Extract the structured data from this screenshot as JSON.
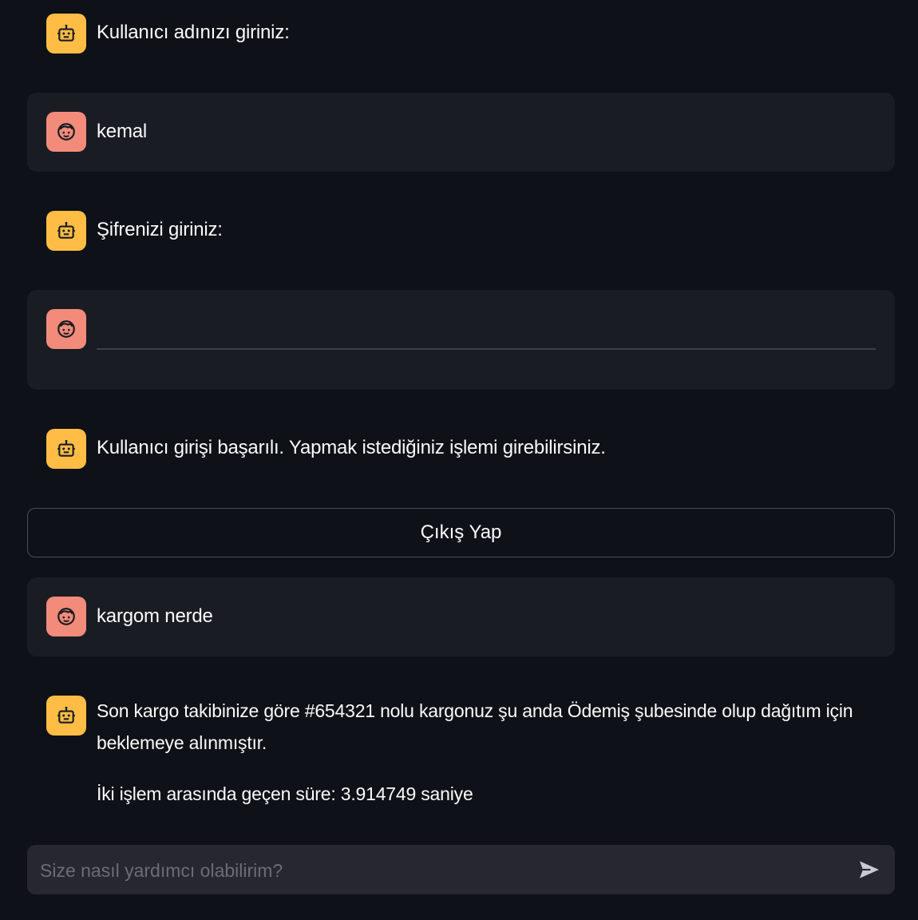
{
  "messages": [
    {
      "role": "bot",
      "text": "Kullanıcı adınızı giriniz:"
    },
    {
      "role": "user",
      "text": "kemal"
    },
    {
      "role": "bot",
      "text": "Şifrenizi giriniz:"
    },
    {
      "role": "user",
      "password_value": ""
    },
    {
      "role": "bot",
      "text": "Kullanıcı girişi başarılı. Yapmak istediğiniz işlemi girebilirsiniz."
    },
    {
      "role": "user",
      "text": "kargom nerde"
    },
    {
      "role": "bot",
      "line1": "Son kargo takibinize göre #654321 nolu kargonuz şu anda Ödemiş şubesinde olup dağıtım için",
      "line2": "beklemeye alınmıştır.",
      "line3": "İki işlem arasında geçen süre: 3.914749 saniye"
    }
  ],
  "logout_button": {
    "label": "Çıkış Yap"
  },
  "chat_input": {
    "placeholder": "Size nasıl yardımcı olabilirim?",
    "value": ""
  },
  "icons": {
    "bot": "robot-icon",
    "user": "face-icon",
    "send": "send-icon"
  },
  "colors": {
    "background": "#0e1117",
    "user_bubble": "#1a1c24",
    "bot_avatar": "#ffbd45",
    "user_avatar": "#f28b7a",
    "input": "#262730"
  }
}
